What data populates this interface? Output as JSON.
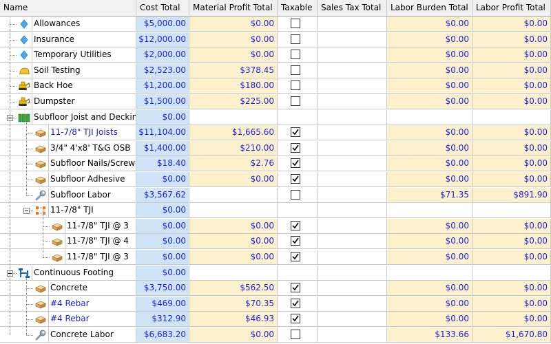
{
  "columns": [
    "Name",
    "Cost Total",
    "Material Profit Total",
    "Taxable",
    "Sales Tax Total",
    "Labor Burden Total",
    "Labor Profit Total"
  ],
  "rows": [
    {
      "level": 1,
      "icon": "diamond-icon",
      "name": "Allowances",
      "link": false,
      "cost": "$5,000.00",
      "mat": "$0.00",
      "tax": false,
      "tax_visible": true,
      "burden": "$0.00",
      "labor": "$0.00"
    },
    {
      "level": 1,
      "icon": "diamond-icon",
      "name": "Insurance",
      "link": false,
      "cost": "$12,000.00",
      "mat": "$0.00",
      "tax": false,
      "tax_visible": true,
      "burden": "$0.00",
      "labor": "$0.00"
    },
    {
      "level": 1,
      "icon": "diamond-icon",
      "name": "Temporary Utilities",
      "link": false,
      "cost": "$2,000.00",
      "mat": "$0.00",
      "tax": false,
      "tax_visible": true,
      "burden": "$0.00",
      "labor": "$0.00"
    },
    {
      "level": 1,
      "icon": "hard-hat-icon",
      "name": "Soil Testing",
      "link": false,
      "cost": "$2,523.00",
      "mat": "$378.45",
      "tax": false,
      "tax_visible": true,
      "burden": "$0.00",
      "labor": "$0.00"
    },
    {
      "level": 1,
      "icon": "backhoe-icon",
      "name": "Back Hoe",
      "link": false,
      "cost": "$1,200.00",
      "mat": "$180.00",
      "tax": false,
      "tax_visible": true,
      "burden": "$0.00",
      "labor": "$0.00"
    },
    {
      "level": 1,
      "icon": "backhoe-icon",
      "name": "Dumpster",
      "link": false,
      "cost": "$1,500.00",
      "mat": "$225.00",
      "tax": false,
      "tax_visible": true,
      "burden": "$0.00",
      "labor": "$0.00"
    },
    {
      "level": 1,
      "icon": "assembly-icon",
      "name": "Subfloor Joist and Decking",
      "link": false,
      "cost": "$0.00",
      "mat": "",
      "tax": false,
      "tax_visible": false,
      "burden": "",
      "labor": "",
      "group": true
    },
    {
      "level": 2,
      "icon": "lumber-icon",
      "name": "11-7/8\" TJI Joists",
      "link": true,
      "cost": "$11,104.00",
      "mat": "$1,665.60",
      "tax": true,
      "tax_visible": true,
      "burden": "$0.00",
      "labor": "$0.00"
    },
    {
      "level": 2,
      "icon": "lumber-icon",
      "name": "3/4\" 4'x8' T&G OSB",
      "link": false,
      "cost": "$1,400.00",
      "mat": "$210.00",
      "tax": true,
      "tax_visible": true,
      "burden": "$0.00",
      "labor": "$0.00"
    },
    {
      "level": 2,
      "icon": "lumber-icon",
      "name": "Subfloor Nails/Screws",
      "link": false,
      "cost": "$18.40",
      "mat": "$2.76",
      "tax": true,
      "tax_visible": true,
      "burden": "$0.00",
      "labor": "$0.00"
    },
    {
      "level": 2,
      "icon": "lumber-icon",
      "name": "Subfloor Adhesive",
      "link": false,
      "cost": "$0.00",
      "mat": "$0.00",
      "tax": true,
      "tax_visible": true,
      "burden": "$0.00",
      "labor": "$0.00"
    },
    {
      "level": 2,
      "icon": "wrench-icon",
      "name": "Subfloor Labor",
      "link": false,
      "cost": "$3,567.62",
      "mat": "",
      "tax": false,
      "tax_visible": true,
      "burden": "$71.35",
      "labor": "$891.90"
    },
    {
      "level": 2,
      "icon": "formula-icon",
      "name": "11-7/8\" TJI",
      "link": false,
      "cost": "$0.00",
      "mat": "",
      "tax": false,
      "tax_visible": false,
      "burden": "",
      "labor": "",
      "group": true
    },
    {
      "level": 3,
      "icon": "lumber-icon",
      "name": "11-7/8\" TJI @ 3",
      "link": false,
      "cost": "$0.00",
      "mat": "$0.00",
      "tax": true,
      "tax_visible": true,
      "burden": "$0.00",
      "labor": "$0.00"
    },
    {
      "level": 3,
      "icon": "lumber-icon",
      "name": "11-7/8\" TJI @ 4",
      "link": false,
      "cost": "$0.00",
      "mat": "$0.00",
      "tax": true,
      "tax_visible": true,
      "burden": "$0.00",
      "labor": "$0.00"
    },
    {
      "level": 3,
      "icon": "lumber-icon",
      "name": "11-7/8\" TJI @ 3",
      "link": false,
      "cost": "$0.00",
      "mat": "$0.00",
      "tax": true,
      "tax_visible": true,
      "burden": "$0.00",
      "labor": "$0.00"
    },
    {
      "level": 1,
      "icon": "bracket-icon",
      "name": "Continuous Footing",
      "link": false,
      "cost": "$0.00",
      "mat": "",
      "tax": false,
      "tax_visible": false,
      "burden": "",
      "labor": "",
      "group": true
    },
    {
      "level": 2,
      "icon": "lumber-icon",
      "name": "Concrete",
      "link": false,
      "cost": "$3,750.00",
      "mat": "$562.50",
      "tax": true,
      "tax_visible": true,
      "burden": "$0.00",
      "labor": "$0.00"
    },
    {
      "level": 2,
      "icon": "lumber-icon",
      "name": "#4 Rebar",
      "link": true,
      "cost": "$469.00",
      "mat": "$70.35",
      "tax": true,
      "tax_visible": true,
      "burden": "$0.00",
      "labor": "$0.00"
    },
    {
      "level": 2,
      "icon": "lumber-icon",
      "name": "#4 Rebar",
      "link": true,
      "cost": "$312.90",
      "mat": "$46.93",
      "tax": true,
      "tax_visible": true,
      "burden": "$0.00",
      "labor": "$0.00"
    },
    {
      "level": 2,
      "icon": "wrench-icon",
      "name": "Concrete Labor",
      "link": false,
      "cost": "$6,683.20",
      "mat": "$0.00",
      "tax": false,
      "tax_visible": true,
      "burden": "$133.66",
      "labor": "$1,670.80"
    }
  ],
  "colors": {
    "cost_bg": "#cfe4f7",
    "profit_bg": "#fcf1cc",
    "value_text": "#1e1ee0"
  }
}
